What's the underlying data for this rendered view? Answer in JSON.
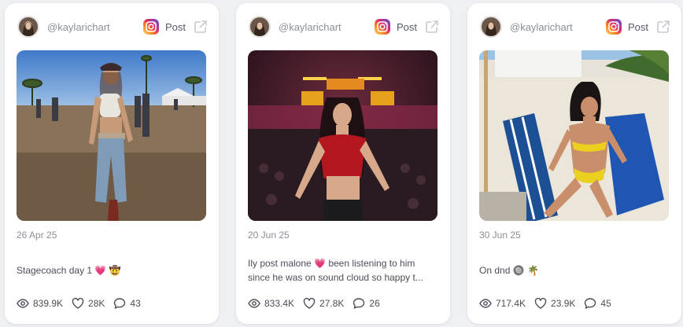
{
  "cards": [
    {
      "handle": "@kaylarichart",
      "post_label": "Post",
      "date": "26 Apr 25",
      "caption": "Stagecoach day 1 💗 🤠",
      "caption_line2": "",
      "views": "839.9K",
      "likes": "28K",
      "comments": "43"
    },
    {
      "handle": "@kaylarichart",
      "post_label": "Post",
      "date": "20 Jun 25",
      "caption": "Ily post malone 💗 been listening to him",
      "caption_line2": "since he was on sound cloud so happy t...",
      "views": "833.4K",
      "likes": "27.8K",
      "comments": "26"
    },
    {
      "handle": "@kaylarichart",
      "post_label": "Post",
      "date": "30 Jun 25",
      "caption": "On dnd 🔘 🌴",
      "caption_line2": "",
      "views": "717.4K",
      "likes": "23.9K",
      "comments": "45"
    }
  ],
  "icons": {
    "platform": "instagram-icon",
    "open": "external-link-icon",
    "views": "eye-icon",
    "likes": "heart-icon",
    "comments": "comment-icon"
  },
  "colors": {
    "background": "#eef0f3",
    "card": "#ffffff",
    "muted_text": "#8a8f99",
    "body_text": "#4a4f59"
  }
}
